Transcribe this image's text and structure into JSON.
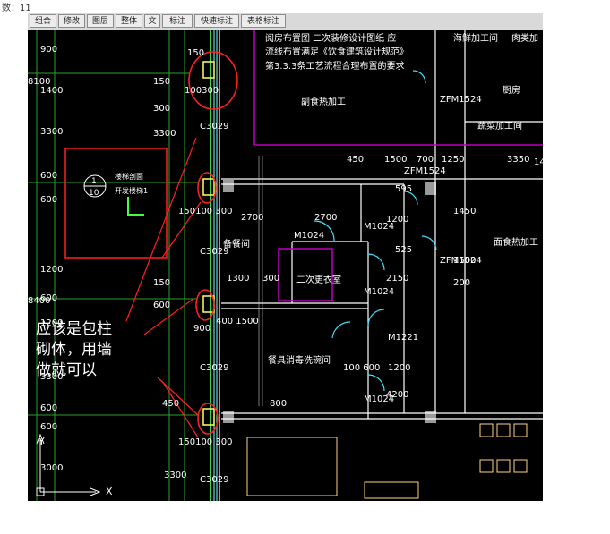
{
  "status": {
    "count_label": "数：11"
  },
  "toolbar": {
    "buttons": [
      "组合",
      "修改",
      "图层",
      "整体",
      "文",
      "标注",
      "快速标注",
      "表格标注"
    ]
  },
  "drawing": {
    "notes": [
      "阅房布置图 二次装修设计图纸 应",
      "流线布置满足《饮食建筑设计规范》",
      "第3.3.3条工艺流程合理布置的要求"
    ],
    "rooms": {
      "sub_food": "副食热加工",
      "kitchen": "厨房",
      "veg": "蔬菜加工间",
      "pastry": "面食热加工",
      "dining": "备餐间",
      "changing": "二次更衣室",
      "wash": "餐具消毒洗碗间",
      "cold": "海鲜加工间",
      "dry": "肉类加"
    },
    "doors": [
      "M1024",
      "M1024",
      "M1024",
      "M1221",
      "M1024",
      "ZFM1524",
      "ZFM1524",
      "ZFM1524"
    ],
    "pillar_labels": [
      "C3029",
      "C3029",
      "C3029",
      "C3029"
    ],
    "left_dims": [
      "900",
      "1400",
      "3300",
      "600",
      "600",
      "1200",
      "600",
      "3300",
      "600",
      "600",
      "3000",
      "3300"
    ],
    "left_big_dims": [
      "8100",
      "8400"
    ],
    "stair_labels": [
      "楼梯剖面",
      "开发楼梯1"
    ],
    "stair_num_top": "1",
    "stair_num_bottom": "10",
    "dims": {
      "d150a": "150",
      "d150b": "150",
      "d300a": "300",
      "d100300": "100300",
      "d300b": "300",
      "d100": "100",
      "d300c": "300",
      "d3300": "3300",
      "d150100300a": "150100 300",
      "d150100300b": "150100 300",
      "d2700a": "2700",
      "d2700b": "2700",
      "d1300": "1300",
      "d300d": "300",
      "d1500a": "1500",
      "d700": "700",
      "d1250": "1250",
      "d3350": "3350",
      "d450a": "450",
      "d450b": "450",
      "d4001500": "400 1500",
      "d900": "900",
      "d1200a": "1200",
      "d1200b": "1200",
      "d2150": "2150",
      "d525": "525",
      "d595": "595",
      "d1450": "1450",
      "d1500b": "1500",
      "d200": "200",
      "d4200": "4200",
      "d100600": "100 600",
      "d800": "800",
      "d600a": "600",
      "d1200c": "1200",
      "d1400": "1400",
      "d150c": "150"
    }
  },
  "annotation": {
    "text": "应该是包柱砌体，用墙做就可以"
  },
  "axes": {
    "x": "X",
    "y": "Y"
  }
}
